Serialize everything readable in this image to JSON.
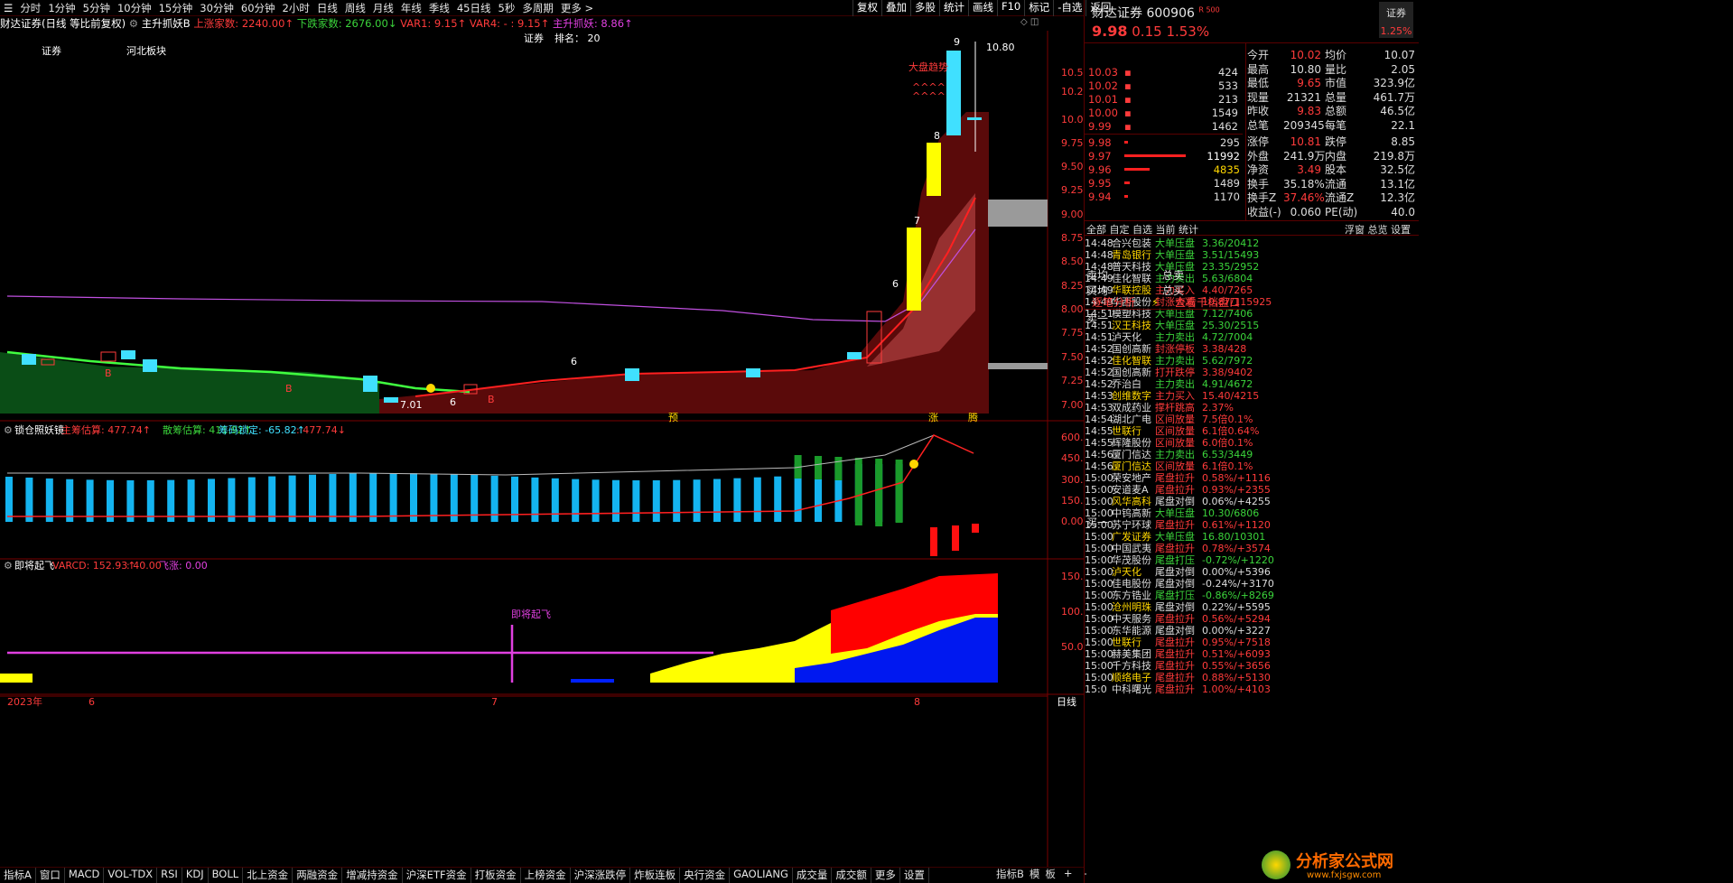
{
  "topbar": {
    "menu": "分时",
    "periods": [
      "1分钟",
      "5分钟",
      "10分钟",
      "15分钟",
      "30分钟",
      "60分钟",
      "2小时",
      "日线",
      "周线",
      "月线",
      "年线",
      "季线",
      "45日线",
      "5秒",
      "多周期",
      "更多 >"
    ],
    "right": [
      "复权",
      "叠加",
      "多股",
      "统计",
      "画线",
      "F10",
      "标记",
      "-自选",
      "返回"
    ]
  },
  "ind1": {
    "title": "财达证券(日线 等比前复权)",
    "name": "主升抓妖B",
    "up": "上涨家数: 2240.00↑",
    "down": "下跌家数: 2676.00↓",
    "var1": "VAR1: 9.15↑",
    "var4": "VAR4: - : 9.15↑",
    "main": "主升抓妖: 8.86↑"
  },
  "main_labels": {
    "sector": "证券",
    "rank": "排名： 20",
    "board1": "证券",
    "board2": "河北板块",
    "trend": "大盘趋势",
    "carets": "^^^^",
    "high": "10.80",
    "low": "7.01",
    "b": "B",
    "six": "6",
    "n6": "6",
    "n7": "7",
    "n8": "8",
    "n9": "9",
    "yu": "预",
    "zhang": "涨",
    "teng": "腾"
  },
  "main_axis": [
    "10.50",
    "10.25",
    "10.00",
    "9.75",
    "9.50",
    "9.25",
    "9.00",
    "8.75",
    "8.50",
    "8.25",
    "8.00",
    "7.75",
    "7.50",
    "7.25",
    "7.00"
  ],
  "ind2": {
    "name": "锁仓照妖镜",
    "a": "主筹估算: 477.74↑",
    "b": "散筹估算: 411.92↑",
    "c": "筹码锁定: -65.82↑",
    "d": ": 477.74↓",
    "axis": [
      "600.0",
      "450.0",
      "300.0",
      "150.0",
      "0.00"
    ]
  },
  "ind3": {
    "name": "即将起飞",
    "a": "VARCD: 152.93↑",
    "b": ": 40.00",
    "c": "飞涨: 0.00",
    "label": "即将起飞",
    "axis": [
      "150.0",
      "100.0",
      "50.00"
    ]
  },
  "date_axis": {
    "y": "2023年",
    "m6": "6",
    "m7": "7",
    "m8": "8",
    "btn": "日线"
  },
  "bottombar": [
    "指标A",
    "窗口",
    "MACD",
    "VOL-TDX",
    "RSI",
    "KDJ",
    "BOLL",
    "北上资金",
    "两融资金",
    "增减持资金",
    "沪深ETF资金",
    "打板资金",
    "上榜资金",
    "沪深涨跌停",
    "炸板连板",
    "央行资金",
    "GAOLIANG",
    "成交量",
    "成交额",
    "更多",
    "设置"
  ],
  "bottomright": [
    "指标B",
    "模",
    "板",
    "+",
    "-"
  ],
  "quote": {
    "name": "财达证券",
    "code": "600906",
    "tag": "R 500",
    "price": "9.98",
    "chg": "0.15",
    "pct": "1.53%",
    "btn": "证券",
    "btnpct": "1.25%"
  },
  "asks": [
    [
      "10.03",
      "424"
    ],
    [
      "10.02",
      "533"
    ],
    [
      "10.01",
      "213"
    ],
    [
      "10.00",
      "1549"
    ],
    [
      "9.99",
      "1462"
    ]
  ],
  "bids": [
    [
      "9.98",
      "295"
    ],
    [
      "9.97",
      "11992"
    ],
    [
      "9.96",
      "4835"
    ],
    [
      "9.95",
      "1489"
    ],
    [
      "9.94",
      "1170"
    ]
  ],
  "stats": [
    [
      "今开",
      "10.02",
      "均价",
      "10.07"
    ],
    [
      "最高",
      "10.80",
      "量比",
      "2.05"
    ],
    [
      "最低",
      "9.65",
      "市值",
      "323.9亿"
    ],
    [
      "现量",
      "21321",
      "总量",
      "461.7万"
    ],
    [
      "昨收",
      "9.83",
      "总额",
      "46.5亿"
    ],
    [
      "总笔",
      "209345",
      "每笔",
      "22.1"
    ]
  ],
  "stats2": [
    [
      "涨停",
      "10.81",
      "跌停",
      "8.85"
    ],
    [
      "外盘",
      "241.9万",
      "内盘",
      "219.8万"
    ],
    [
      "净资",
      "3.49",
      "股本",
      "32.5亿"
    ],
    [
      "换手",
      "35.18%",
      "流通",
      "13.1亿"
    ],
    [
      "换手Z",
      "37.46%",
      "流通Z",
      "12.3亿"
    ],
    [
      "收益(-)",
      "0.060",
      "PE(动)",
      "40.0"
    ]
  ],
  "watch_tabs": [
    "全部",
    "自定",
    "自选",
    "当前",
    "统计"
  ],
  "watch_tabs2": [
    "浮窗",
    "总览",
    "设置"
  ],
  "news": [
    [
      "14:48",
      "合兴包装",
      "大单压盘",
      "3.36/20412"
    ],
    [
      "14:48",
      "青岛银行",
      "大单压盘",
      "3.51/15493"
    ],
    [
      "14:48",
      "普天科技",
      "大单压盘",
      "23.35/2952"
    ],
    [
      "14:49",
      "佳化智联",
      "主力卖出",
      "5.63/6804"
    ],
    [
      "14:49",
      "华联控股",
      "主力买入",
      "4.40/7265"
    ],
    [
      "14:49",
      "华西股份",
      "封涨大减",
      "10.87/115925"
    ],
    [
      "14:51",
      "模塑科技",
      "大单压盘",
      "7.12/7406"
    ],
    [
      "14:51",
      "汉王科技",
      "大单压盘",
      "25.30/2515"
    ],
    [
      "14:51",
      "泸天化",
      "主力卖出",
      "4.72/7004"
    ],
    [
      "14:52",
      "国创高新",
      "封涨停板",
      "3.38/428"
    ],
    [
      "14:52",
      "佳化智联",
      "主力卖出",
      "5.62/7972"
    ],
    [
      "14:52",
      "国创高新",
      "打开跌停",
      "3.38/9402"
    ],
    [
      "14:52",
      "乔治白",
      "主力卖出",
      "4.91/4672"
    ],
    [
      "14:53",
      "创维数字",
      "主力买入",
      "15.40/4215"
    ],
    [
      "14:53",
      "双成药业",
      "撑杆跳高",
      "2.37%"
    ],
    [
      "14:54",
      "湖北广电",
      "区间放量",
      "7.5倍0.1%"
    ],
    [
      "14:55",
      "世联行",
      "区间放量",
      "6.1倍0.64%"
    ],
    [
      "14:55",
      "辉隆股份",
      "区间放量",
      "6.0倍0.1%"
    ],
    [
      "14:56",
      "厦门信达",
      "主力卖出",
      "6.53/3449"
    ],
    [
      "14:56",
      "厦门信达",
      "区间放量",
      "6.1倍0.1%"
    ],
    [
      "15:00",
      "荣安地产",
      "尾盘拉升",
      "0.58%/+1116"
    ],
    [
      "15:00",
      "安道麦A",
      "尾盘拉升",
      "0.93%/+2355"
    ],
    [
      "15:00",
      "风华高科",
      "尾盘对倒",
      "0.06%/+4255"
    ],
    [
      "15:00",
      "中钨高新",
      "大单压盘",
      "10.30/6806"
    ],
    [
      "15:00",
      "苏宁环球",
      "尾盘拉升",
      "0.61%/+1120"
    ],
    [
      "15:00",
      "广发证券",
      "大单压盘",
      "16.80/10301"
    ],
    [
      "15:00",
      "中国武夷",
      "尾盘拉升",
      "0.78%/+3574"
    ],
    [
      "15:00",
      "华茂股份",
      "尾盘打压",
      "-0.72%/+1220"
    ],
    [
      "15:00",
      "泸天化",
      "尾盘对倒",
      "0.00%/+5396"
    ],
    [
      "15:00",
      "佳电股份",
      "尾盘对倒",
      "-0.24%/+3170"
    ],
    [
      "15:00",
      "东方锆业",
      "尾盘打压",
      "-0.86%/+8269"
    ],
    [
      "15:00",
      "沧州明珠",
      "尾盘对倒",
      "0.22%/+5595"
    ],
    [
      "15:00",
      "中天服务",
      "尾盘拉升",
      "0.56%/+5294"
    ],
    [
      "15:00",
      "东华能源",
      "尾盘对倒",
      "0.00%/+3227"
    ],
    [
      "15:00",
      "世联行",
      "尾盘拉升",
      "0.95%/+7518"
    ],
    [
      "15:00",
      "赫美集团",
      "尾盘拉升",
      "0.51%/+6093"
    ],
    [
      "15:00",
      "千方科技",
      "尾盘拉升",
      "0.55%/+3656"
    ],
    [
      "15:00",
      "顺络电子",
      "尾盘拉升",
      "0.88%/+5130"
    ],
    [
      "15:0",
      "中科曙光",
      "尾盘拉升",
      "1.00%/+4103"
    ]
  ],
  "mid": {
    "sell_avg": "卖均",
    "total_sell": "总卖",
    "buy_avg": "买均",
    "total_buy": "总买",
    "tick_link": "逐笔分析",
    "depth_link": "查看千档盘口",
    "sell1": "卖一",
    "buy1": "买一"
  },
  "watermark": {
    "cn": "分析家公式网",
    "url": "www.fxjsgw.com"
  },
  "colors": {
    "up": "#ff3b3b",
    "down": "#3bd43b",
    "cyan": "#40e0ff",
    "yellow": "#ffff00",
    "magenta": "#e040e0"
  }
}
